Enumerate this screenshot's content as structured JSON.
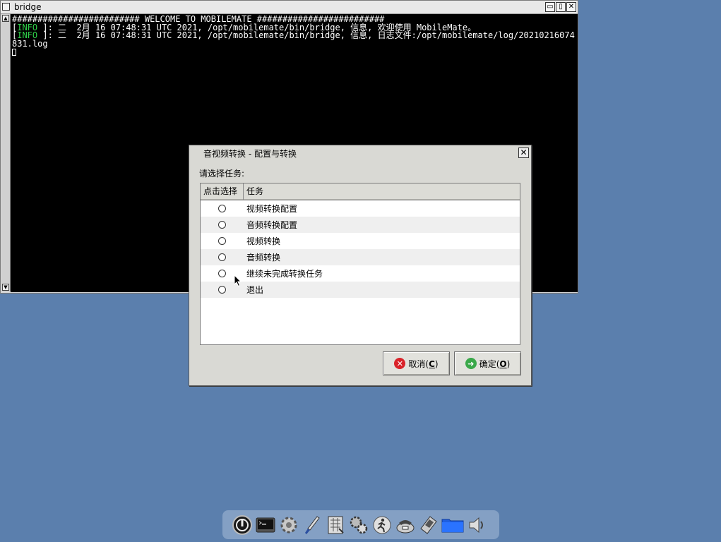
{
  "terminal": {
    "title": "bridge",
    "lines": [
      "######################### WELCOME TO MOBILEMATE #########################",
      "",
      "",
      ""
    ],
    "log1": {
      "open": "[",
      "tag": "INFO",
      "rest": " ]: 二  2月 16 07:48:31 UTC 2021, /opt/mobilemate/bin/bridge, 信息, 欢迎使用 MobileMate。"
    },
    "log2": {
      "open": "[",
      "tag": "INFO",
      "rest": " ]: 二  2月 16 07:48:31 UTC 2021, /opt/mobilemate/bin/bridge, 信息, 日志文件:/opt/mobilemate/log/20210216074831.log"
    },
    "scroll_up": "▲",
    "scroll_down": "▼",
    "wm_buttons": {
      "minimize": "▭",
      "maximize": "▯",
      "close": "✕"
    }
  },
  "dialog": {
    "title": "音视频转换 - 配置与转换",
    "close": "✕",
    "prompt": "请选择任务:",
    "columns": {
      "select": "点击选择",
      "task": "任务"
    },
    "tasks": [
      {
        "label": "视频转换配置",
        "selected": false
      },
      {
        "label": "音频转换配置",
        "selected": false
      },
      {
        "label": "视频转换",
        "selected": false
      },
      {
        "label": "音频转换",
        "selected": false
      },
      {
        "label": "继续未完成转换任务",
        "selected": false
      },
      {
        "label": "退出",
        "selected": false
      }
    ],
    "cancel": {
      "icon": "✕",
      "text": "取消(",
      "key": "C",
      "end": ")"
    },
    "ok": {
      "icon": "➜",
      "text": "确定(",
      "key": "O",
      "end": ")"
    }
  },
  "dock": {
    "icons": [
      "power-icon",
      "terminal-icon",
      "settings-gear-icon",
      "brush-icon",
      "calculator-icon",
      "gears-icon",
      "run-icon",
      "phone-icon",
      "mobile-phone-icon",
      "folder-icon",
      "speaker-icon"
    ]
  }
}
